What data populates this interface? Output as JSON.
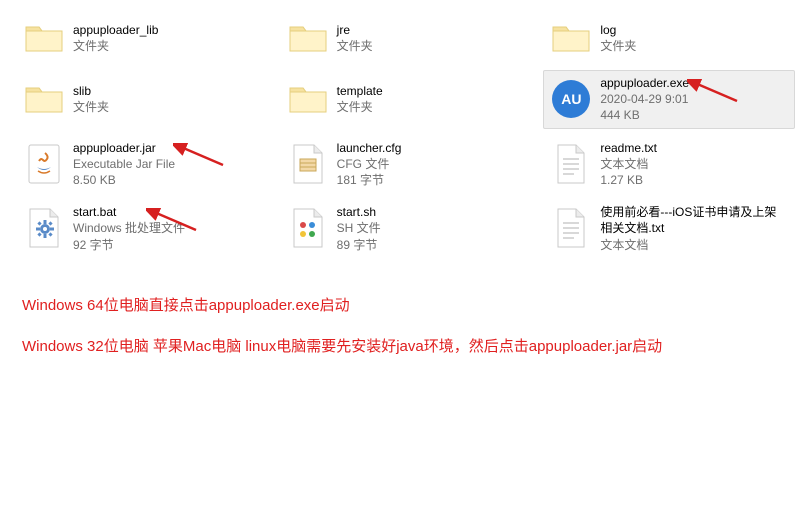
{
  "files": {
    "appuploader_lib": {
      "name": "appuploader_lib",
      "type": "文件夹"
    },
    "jre": {
      "name": "jre",
      "type": "文件夹"
    },
    "log": {
      "name": "log",
      "type": "文件夹"
    },
    "slib": {
      "name": "slib",
      "type": "文件夹"
    },
    "template": {
      "name": "template",
      "type": "文件夹"
    },
    "exe": {
      "name": "appuploader.exe",
      "date": "2020-04-29 9:01",
      "size": "444 KB"
    },
    "jar": {
      "name": "appuploader.jar",
      "type": "Executable Jar File",
      "size": "8.50 KB"
    },
    "cfg": {
      "name": "launcher.cfg",
      "type": "CFG 文件",
      "size": "181 字节"
    },
    "readme": {
      "name": "readme.txt",
      "type": "文本文档",
      "size": "1.27 KB"
    },
    "bat": {
      "name": "start.bat",
      "type": "Windows 批处理文件",
      "size": "92 字节"
    },
    "sh": {
      "name": "start.sh",
      "type": "SH 文件",
      "size": "89 字节"
    },
    "guide": {
      "name": "使用前必看---iOS证书申请及上架相关文档.txt",
      "type": "文本文档"
    }
  },
  "notes": {
    "line1": "Windows 64位电脑直接点击appuploader.exe启动",
    "line2": "Windows 32位电脑 苹果Mac电脑 linux电脑需要先安装好java环境，然后点击appuploader.jar启动"
  },
  "exe_label": "AU"
}
